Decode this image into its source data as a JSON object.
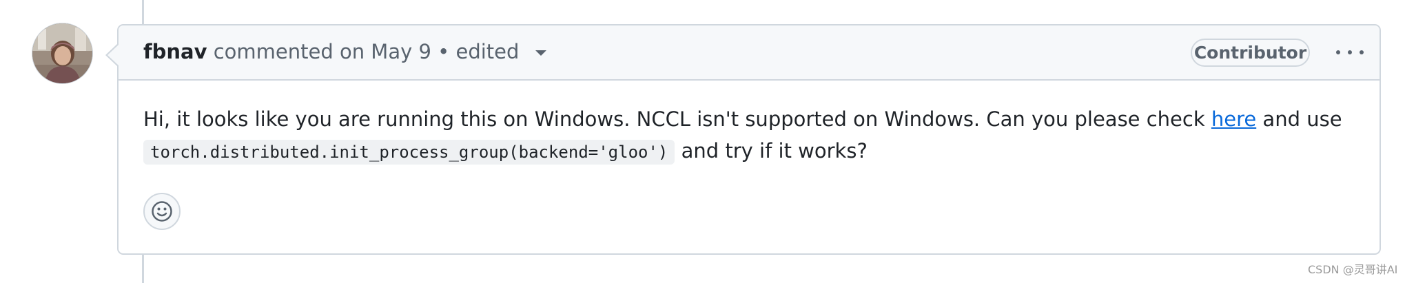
{
  "comment": {
    "author": "fbnav",
    "meta_text": "commented on May 9 • edited",
    "badge": "Contributor",
    "body_line1_text": "Hi, it looks like you are running this on Windows. NCCL isn't supported on Windows. Can you please check ",
    "body_link_text": "here",
    "body_line1_suffix": " and use",
    "code_snippet": "torch.distributed.init_process_group(backend='gloo')",
    "body_line2_suffix": " and try if it works?"
  },
  "icons": {
    "options": "kebab-horizontal-icon",
    "reaction": "smiley-icon",
    "edit_menu": "triangle-down-icon"
  },
  "watermark": "CSDN @灵哥讲AI",
  "colors": {
    "link": "#0969da",
    "border": "#d0d7de",
    "header_bg": "#f6f8fa",
    "muted_text": "#59636e",
    "text": "#1f2328"
  }
}
